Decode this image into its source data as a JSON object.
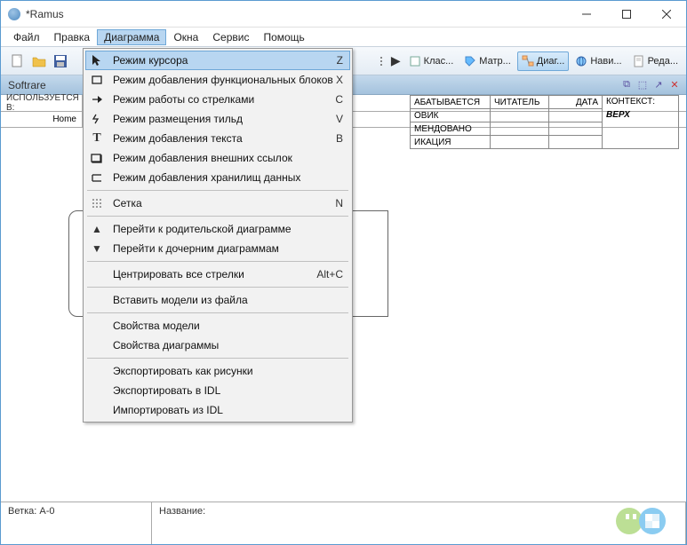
{
  "window": {
    "title": "*Ramus"
  },
  "menubar": {
    "items": [
      "Файл",
      "Правка",
      "Диаграмма",
      "Окна",
      "Сервис",
      "Помощь"
    ],
    "active_index": 2
  },
  "toolbar": {
    "right": [
      {
        "label": "Клас...",
        "icon": "square-icon"
      },
      {
        "label": "Матр...",
        "icon": "tag-icon"
      },
      {
        "label": "Диаг...",
        "icon": "diagram-icon",
        "active": true
      },
      {
        "label": "Нави...",
        "icon": "globe-icon"
      },
      {
        "label": "Реда...",
        "icon": "page-icon"
      }
    ]
  },
  "subheader": {
    "label": "Softrare"
  },
  "info": {
    "row1_left_label": "ИСПОЛЬЗУЕТСЯ В:",
    "row2_left_label": "Home"
  },
  "right_table": {
    "c1": "АБАТЫВАЕТСЯ",
    "c2": "ЧИТАТЕЛЬ",
    "c3": "ДАТА",
    "c4": "КОНТЕКСТ:",
    "r2c1": "ОВИК",
    "r2c4": "ВЕРХ",
    "r3c1": "МЕНДОВАНО",
    "r4c1": "ИКАЦИЯ"
  },
  "dropdown": {
    "items": [
      {
        "icon": "cursor",
        "label": "Режим курсора",
        "shortcut": "Z",
        "highlighted": true
      },
      {
        "icon": "box",
        "label": "Режим добавления функциональных блоков",
        "shortcut": "X"
      },
      {
        "icon": "arrow",
        "label": "Режим работы со стрелками",
        "shortcut": "C"
      },
      {
        "icon": "tilde",
        "label": "Режим размещения тильд",
        "shortcut": "V"
      },
      {
        "icon": "text",
        "label": "Режим добавления текста",
        "shortcut": "B"
      },
      {
        "icon": "extlink",
        "label": "Режим добавления внешних ссылок",
        "shortcut": ""
      },
      {
        "icon": "datastore",
        "label": "Режим добавления хранилищ данных",
        "shortcut": ""
      },
      {
        "sep": true
      },
      {
        "icon": "grid",
        "label": "Сетка",
        "shortcut": "N"
      },
      {
        "sep": true
      },
      {
        "icon": "triup",
        "label": "Перейти к родительской диаграмме",
        "shortcut": ""
      },
      {
        "icon": "tridown",
        "label": "Перейти к дочерним диаграммам",
        "shortcut": ""
      },
      {
        "sep": true
      },
      {
        "icon": "",
        "label": "Центрировать все стрелки",
        "shortcut": "Alt+C"
      },
      {
        "sep": true
      },
      {
        "icon": "",
        "label": "Вставить модели из файла",
        "shortcut": ""
      },
      {
        "sep": true
      },
      {
        "icon": "",
        "label": "Свойства модели",
        "shortcut": ""
      },
      {
        "icon": "",
        "label": "Свойства диаграммы",
        "shortcut": ""
      },
      {
        "sep": true
      },
      {
        "icon": "",
        "label": "Экспортировать как рисунки",
        "shortcut": ""
      },
      {
        "icon": "",
        "label": "Экспортировать в IDL",
        "shortcut": ""
      },
      {
        "icon": "",
        "label": "Импортировать из IDL",
        "shortcut": ""
      }
    ]
  },
  "statusbar": {
    "branch_label": "Ветка:",
    "branch_value": "A-0",
    "name_label": "Название:"
  }
}
